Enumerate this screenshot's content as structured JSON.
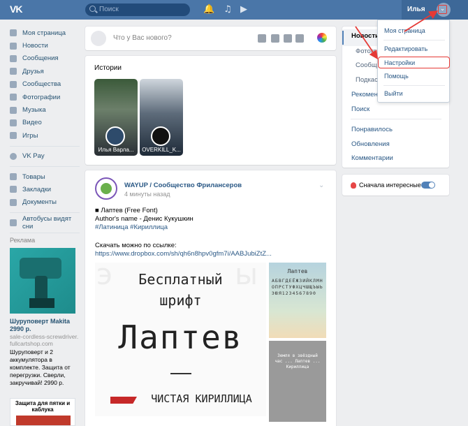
{
  "header": {
    "logo": "VK",
    "search_placeholder": "Поиск",
    "icons": [
      "bell-icon",
      "music-icon",
      "video-icon"
    ],
    "user_name": "Илья",
    "chevron": "chevron-down-icon"
  },
  "sidebar": {
    "items": [
      {
        "label": "Моя страница",
        "icon": "home-icon"
      },
      {
        "label": "Новости",
        "icon": "news-icon"
      },
      {
        "label": "Сообщения",
        "icon": "messages-icon"
      },
      {
        "label": "Друзья",
        "icon": "friends-icon"
      },
      {
        "label": "Сообщества",
        "icon": "groups-icon"
      },
      {
        "label": "Фотографии",
        "icon": "photo-icon"
      },
      {
        "label": "Музыка",
        "icon": "music-icon"
      },
      {
        "label": "Видео",
        "icon": "video-icon"
      },
      {
        "label": "Игры",
        "icon": "games-icon"
      }
    ],
    "pay": {
      "label": "VK Pay",
      "icon": "vkpay-icon"
    },
    "items2": [
      {
        "label": "Товары",
        "icon": "goods-icon"
      },
      {
        "label": "Закладки",
        "icon": "bookmarks-icon"
      },
      {
        "label": "Документы",
        "icon": "documents-icon"
      }
    ],
    "extra": {
      "label": "Автобусы видят сни",
      "icon": "app-icon"
    },
    "ads_title": "Реклама",
    "ad": {
      "title": "Шуруповерт Makita 2990 р.",
      "domain": "sale-cordless-screwdriver.fullcartshop.com",
      "text": "Шуруповерт и 2 аккумулятора в комплекте. Защита от перегрузки. Сверли, закручивай! 2990 р."
    },
    "ad2": {
      "title": "Защита для пятки и каблука"
    }
  },
  "composer": {
    "placeholder": "Что у Вас нового?"
  },
  "stories": {
    "title": "Истории",
    "items": [
      {
        "name": "Илья Варла..."
      },
      {
        "name": "OVERKILL_K..."
      }
    ]
  },
  "post": {
    "author": "WAYUP / Сообщество Фрилансеров",
    "time": "4 минуты назад",
    "line1": "■ Лаптев (Free Font)",
    "line2": "Author's name - Денис Кукушкин",
    "tags": "#Латиница #Кириллица",
    "line4": "Скачать можно по ссылке:",
    "link": "https://www.dropbox.com/sh/qh6n8hpv0gfm7i/AABJubiZtZ...",
    "image": {
      "line1": "Бесплатный",
      "line2": "шрифт",
      "line3": "Лаптев",
      "line4": "ЧИСТАЯ КИРИЛЛИЦА"
    },
    "side1": {
      "title": "Лаптев",
      "rows": "АБВГДЕЁЖЗИЙКЛМНОПРСТУФХЦЧШЩЪЫЬЭЮЯ1234567890"
    },
    "side2": {
      "text": "Земля в звёздный час ... Лаптев ... Кириллица"
    }
  },
  "right_nav": {
    "items": [
      "Новости",
      "Фотографии",
      "Сообщества",
      "Подкасты",
      "Рекомендации",
      "Поиск",
      "Понравилось",
      "Обновления",
      "Комментарии"
    ]
  },
  "filter": {
    "label": "Сначала интересные"
  },
  "menu": {
    "items": [
      "Моя страница",
      "Редактировать",
      "Настройки",
      "Помощь",
      "Выйти"
    ]
  },
  "colors": {
    "brand": "#4a76a8",
    "accent": "#5181b8",
    "annotation": "#e53935"
  }
}
